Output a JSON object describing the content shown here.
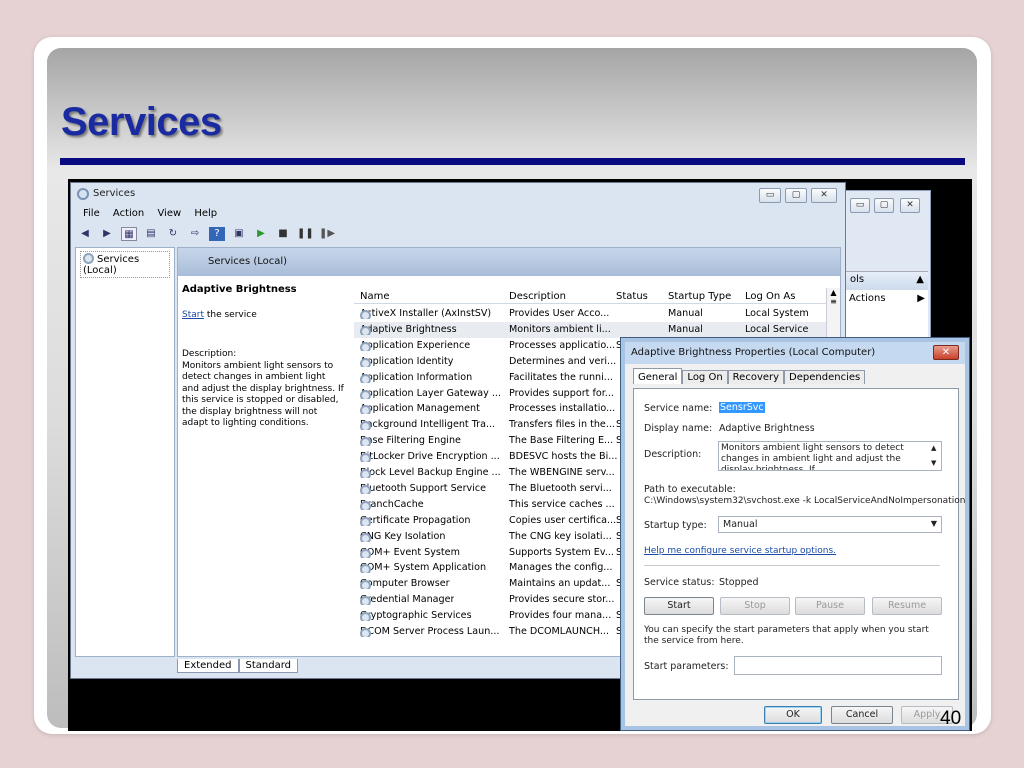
{
  "slide": {
    "title": "Services",
    "page_number": "40"
  },
  "window": {
    "title": "Services",
    "menu": [
      "File",
      "Action",
      "View",
      "Help"
    ],
    "tree_item": "Services (Local)",
    "header": "Services (Local)",
    "extended": {
      "service_name": "Adaptive Brightness",
      "start_link": "Start",
      "start_text": " the service",
      "desc_label": "Description:",
      "desc_text": "Monitors ambient light sensors to detect changes in ambient light and adjust the display brightness. If this service is stopped or disabled, the display brightness will not adapt to lighting conditions."
    },
    "columns": [
      "Name",
      "Description",
      "Status",
      "Startup Type",
      "Log On As"
    ],
    "rows": [
      {
        "name": "ActiveX Installer (AxInstSV)",
        "desc": "Provides User Acco...",
        "status": "",
        "startup": "Manual",
        "logon": "Local System"
      },
      {
        "name": "Adaptive Brightness",
        "desc": "Monitors ambient li...",
        "status": "",
        "startup": "Manual",
        "logon": "Local Service"
      },
      {
        "name": "Application Experience",
        "desc": "Processes applicatio...",
        "status": "S",
        "startup": "",
        "logon": ""
      },
      {
        "name": "Application Identity",
        "desc": "Determines and veri...",
        "status": "",
        "startup": "",
        "logon": ""
      },
      {
        "name": "Application Information",
        "desc": "Facilitates the runni...",
        "status": "",
        "startup": "",
        "logon": ""
      },
      {
        "name": "Application Layer Gateway ...",
        "desc": "Provides support for...",
        "status": "",
        "startup": "",
        "logon": ""
      },
      {
        "name": "Application Management",
        "desc": "Processes installatio...",
        "status": "",
        "startup": "",
        "logon": ""
      },
      {
        "name": "Background Intelligent Tra...",
        "desc": "Transfers files in the...",
        "status": "S",
        "startup": "",
        "logon": ""
      },
      {
        "name": "Base Filtering Engine",
        "desc": "The Base Filtering E...",
        "status": "S",
        "startup": "",
        "logon": ""
      },
      {
        "name": "BitLocker Drive Encryption ...",
        "desc": "BDESVC hosts the Bi...",
        "status": "",
        "startup": "",
        "logon": ""
      },
      {
        "name": "Block Level Backup Engine ...",
        "desc": "The WBENGINE serv...",
        "status": "",
        "startup": "",
        "logon": ""
      },
      {
        "name": "Bluetooth Support Service",
        "desc": "The Bluetooth servi...",
        "status": "",
        "startup": "",
        "logon": ""
      },
      {
        "name": "BranchCache",
        "desc": "This service caches ...",
        "status": "",
        "startup": "",
        "logon": ""
      },
      {
        "name": "Certificate Propagation",
        "desc": "Copies user certifica...",
        "status": "S",
        "startup": "",
        "logon": ""
      },
      {
        "name": "CNG Key Isolation",
        "desc": "The CNG key isolati...",
        "status": "S",
        "startup": "",
        "logon": ""
      },
      {
        "name": "COM+ Event System",
        "desc": "Supports System Ev...",
        "status": "S",
        "startup": "",
        "logon": ""
      },
      {
        "name": "COM+ System Application",
        "desc": "Manages the config...",
        "status": "",
        "startup": "",
        "logon": ""
      },
      {
        "name": "Computer Browser",
        "desc": "Maintains an updat...",
        "status": "S",
        "startup": "",
        "logon": ""
      },
      {
        "name": "Credential Manager",
        "desc": "Provides secure stor...",
        "status": "",
        "startup": "",
        "logon": ""
      },
      {
        "name": "Cryptographic Services",
        "desc": "Provides four mana...",
        "status": "S",
        "startup": "",
        "logon": ""
      },
      {
        "name": "DCOM Server Process Laun...",
        "desc": "The DCOMLAUNCH...",
        "status": "S",
        "startup": "",
        "logon": ""
      }
    ],
    "tabs": [
      "Extended",
      "Standard"
    ]
  },
  "back_window": {
    "header": "ols",
    "item": "Actions"
  },
  "dialog": {
    "title": "Adaptive Brightness Properties (Local Computer)",
    "tabs": [
      "General",
      "Log On",
      "Recovery",
      "Dependencies"
    ],
    "service_name_label": "Service name:",
    "service_name": "SensrSvc",
    "display_name_label": "Display name:",
    "display_name": "Adaptive Brightness",
    "description_label": "Description:",
    "description": "Monitors ambient light sensors to detect changes in ambient light and adjust the display brightness.  If",
    "path_label": "Path to executable:",
    "path": "C:\\Windows\\system32\\svchost.exe -k LocalServiceAndNoImpersonation",
    "startup_label": "Startup type:",
    "startup_value": "Manual",
    "help_link": "Help me configure service startup options.",
    "status_label": "Service status:",
    "status_value": "Stopped",
    "buttons": {
      "start": "Start",
      "stop": "Stop",
      "pause": "Pause",
      "resume": "Resume"
    },
    "hint": "You can specify the start parameters that apply when you start the service from here.",
    "params_label": "Start parameters:",
    "ok": "OK",
    "cancel": "Cancel",
    "apply": "Apply"
  }
}
